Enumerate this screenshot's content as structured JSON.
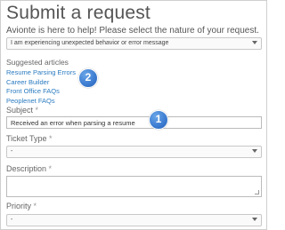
{
  "page": {
    "title": "Submit a request",
    "intro": "Avionte is here to help! Please select the nature of your request."
  },
  "nature_select": {
    "value": "I am experiencing unexpected behavior or error message"
  },
  "suggested": {
    "heading": "Suggested articles",
    "articles": [
      "Resume Parsing Errors",
      "Career Builder",
      "Front Office FAQs",
      "Peoplenet FAQs"
    ]
  },
  "subject": {
    "label": "Subject",
    "required_mark": "*",
    "value": "Received an error when parsing a resume"
  },
  "ticket_type": {
    "label": "Ticket Type",
    "required_mark": "*",
    "value": "-"
  },
  "description": {
    "label": "Description",
    "required_mark": "*",
    "value": ""
  },
  "priority": {
    "label": "Priority",
    "required_mark": "*",
    "value": "-"
  },
  "annotations": {
    "badge_1": "1",
    "badge_2": "2"
  },
  "colors": {
    "link": "#2a7bc0",
    "badge": "#3b7bd0"
  }
}
